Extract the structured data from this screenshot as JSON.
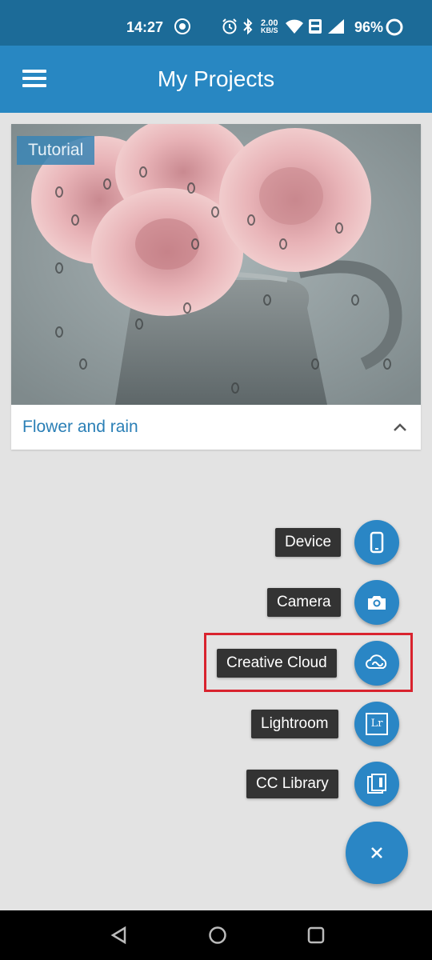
{
  "status_bar": {
    "time": "14:27",
    "speed_value": "2.00",
    "speed_unit": "KB/S",
    "battery": "96%",
    "icons": [
      "chrome-icon",
      "alarm-icon",
      "bluetooth-icon",
      "wifi-icon",
      "volte-icon",
      "signal-icon",
      "battery-icon"
    ]
  },
  "app_bar": {
    "title": "My Projects",
    "menu_icon": "hamburger-menu-icon"
  },
  "project": {
    "badge": "Tutorial",
    "title": "Flower and rain",
    "toggle_icon": "chevron-up-icon"
  },
  "fab_menu": {
    "items": [
      {
        "label": "Device",
        "icon": "phone-icon"
      },
      {
        "label": "Camera",
        "icon": "camera-icon"
      },
      {
        "label": "Creative Cloud",
        "icon": "creative-cloud-icon"
      },
      {
        "label": "Lightroom",
        "icon": "lightroom-icon",
        "icon_text": "Lr"
      },
      {
        "label": "CC Library",
        "icon": "library-icon"
      }
    ],
    "close_icon": "close-icon",
    "highlighted_item": "Creative Cloud"
  },
  "colors": {
    "status_bar": "#1c6b98",
    "app_bar": "#2887c2",
    "fab": "#2a86c5",
    "label_bg": "#333333",
    "highlight": "#d9232e",
    "link_text": "#2a7fb6"
  },
  "nav_bar": {
    "icons": [
      "back-icon",
      "home-icon",
      "recents-icon"
    ]
  }
}
